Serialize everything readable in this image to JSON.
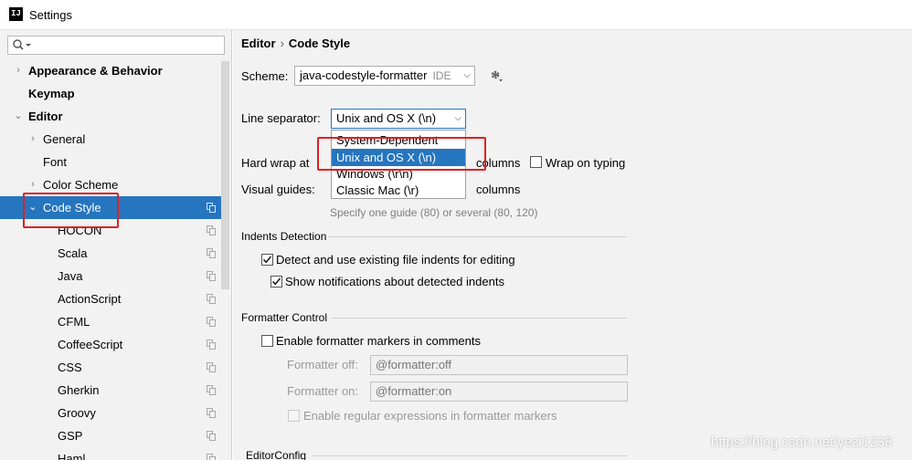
{
  "window": {
    "title": "Settings",
    "app_icon_text": "IJ"
  },
  "sidebar": {
    "items": [
      {
        "label": "Appearance & Behavior",
        "arrow": "›",
        "bold": true
      },
      {
        "label": "Keymap",
        "bold": true
      },
      {
        "label": "Editor",
        "arrow": "⌄",
        "bold": true
      },
      {
        "label": "General",
        "arrow": "›"
      },
      {
        "label": "Font"
      },
      {
        "label": "Color Scheme",
        "arrow": "›"
      },
      {
        "label": "Code Style",
        "arrow": "⌄",
        "selected": true
      },
      {
        "label": "HOCON"
      },
      {
        "label": "Scala"
      },
      {
        "label": "Java"
      },
      {
        "label": "ActionScript"
      },
      {
        "label": "CFML"
      },
      {
        "label": "CoffeeScript"
      },
      {
        "label": "CSS"
      },
      {
        "label": "Gherkin"
      },
      {
        "label": "Groovy"
      },
      {
        "label": "GSP"
      },
      {
        "label": "Haml"
      }
    ]
  },
  "breadcrumb": {
    "parent": "Editor",
    "separator": "›",
    "current": "Code Style"
  },
  "scheme": {
    "label": "Scheme:",
    "value": "java-codestyle-formatter",
    "tag": "IDE"
  },
  "line_separator": {
    "label": "Line separator:",
    "value": "Unix and OS X (\\n)",
    "options": [
      "System-Dependent",
      "Unix and OS X (\\n)",
      "Windows (\\r\\n)",
      "Classic Mac (\\r)"
    ]
  },
  "hard_wrap": {
    "label": "Hard wrap at",
    "unit": "columns",
    "wrap_on_typing": "Wrap on typing"
  },
  "visual_guides": {
    "label": "Visual guides:",
    "unit": "columns",
    "hint": "Specify one guide (80) or several (80, 120)"
  },
  "indents": {
    "title": "Indents Detection",
    "detect": "Detect and use existing file indents for editing",
    "notify": "Show notifications about detected indents"
  },
  "formatter": {
    "title": "Formatter Control",
    "enable_markers": "Enable formatter markers in comments",
    "off_label": "Formatter off:",
    "off_value": "@formatter:off",
    "on_label": "Formatter on:",
    "on_value": "@formatter:on",
    "regex": "Enable regular expressions in formatter markers"
  },
  "editorconfig": {
    "title": "EditorConfig"
  },
  "watermark": "https://blog.csdn.net/yezi1238",
  "colors": {
    "accent": "#2675bf",
    "annotation": "#e02020"
  }
}
